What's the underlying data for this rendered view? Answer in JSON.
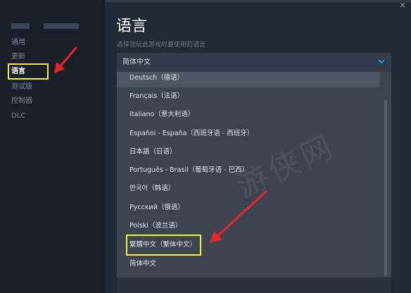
{
  "sidebar": {
    "items": [
      {
        "label": "通用",
        "active": false
      },
      {
        "label": "更新",
        "active": false
      },
      {
        "label": "语言",
        "active": true
      },
      {
        "label": "测试版",
        "active": false
      },
      {
        "label": "控制器",
        "active": false
      },
      {
        "label": "DLC",
        "active": false
      }
    ]
  },
  "main": {
    "title": "语言",
    "subtitle": "选择您玩此游戏时要使用的语言",
    "select": {
      "value": "简体中文",
      "icon": "chevron-down-icon"
    },
    "options": [
      "Deutsch（德语）",
      "Français（法语）",
      "Italiano（意大利语）",
      "Español - España（西班牙语 - 西班牙）",
      "日本語（日语）",
      "Português - Brasil（葡萄牙语 - 巴西）",
      "한국어（韩语）",
      "Русский（俄语）",
      "Polski（波兰语）",
      "繁體中文（繁体中文）",
      "简体中文"
    ],
    "close_icon": "close-icon"
  },
  "annotations": {
    "highlight_color": "#f2ee30",
    "arrow_color": "#e8262c"
  },
  "colors": {
    "accent": "#1a9fff",
    "sidebar_bg": "#1a1f27",
    "panel_bg": "#222a35",
    "dropdown_bg": "#3d4450"
  }
}
